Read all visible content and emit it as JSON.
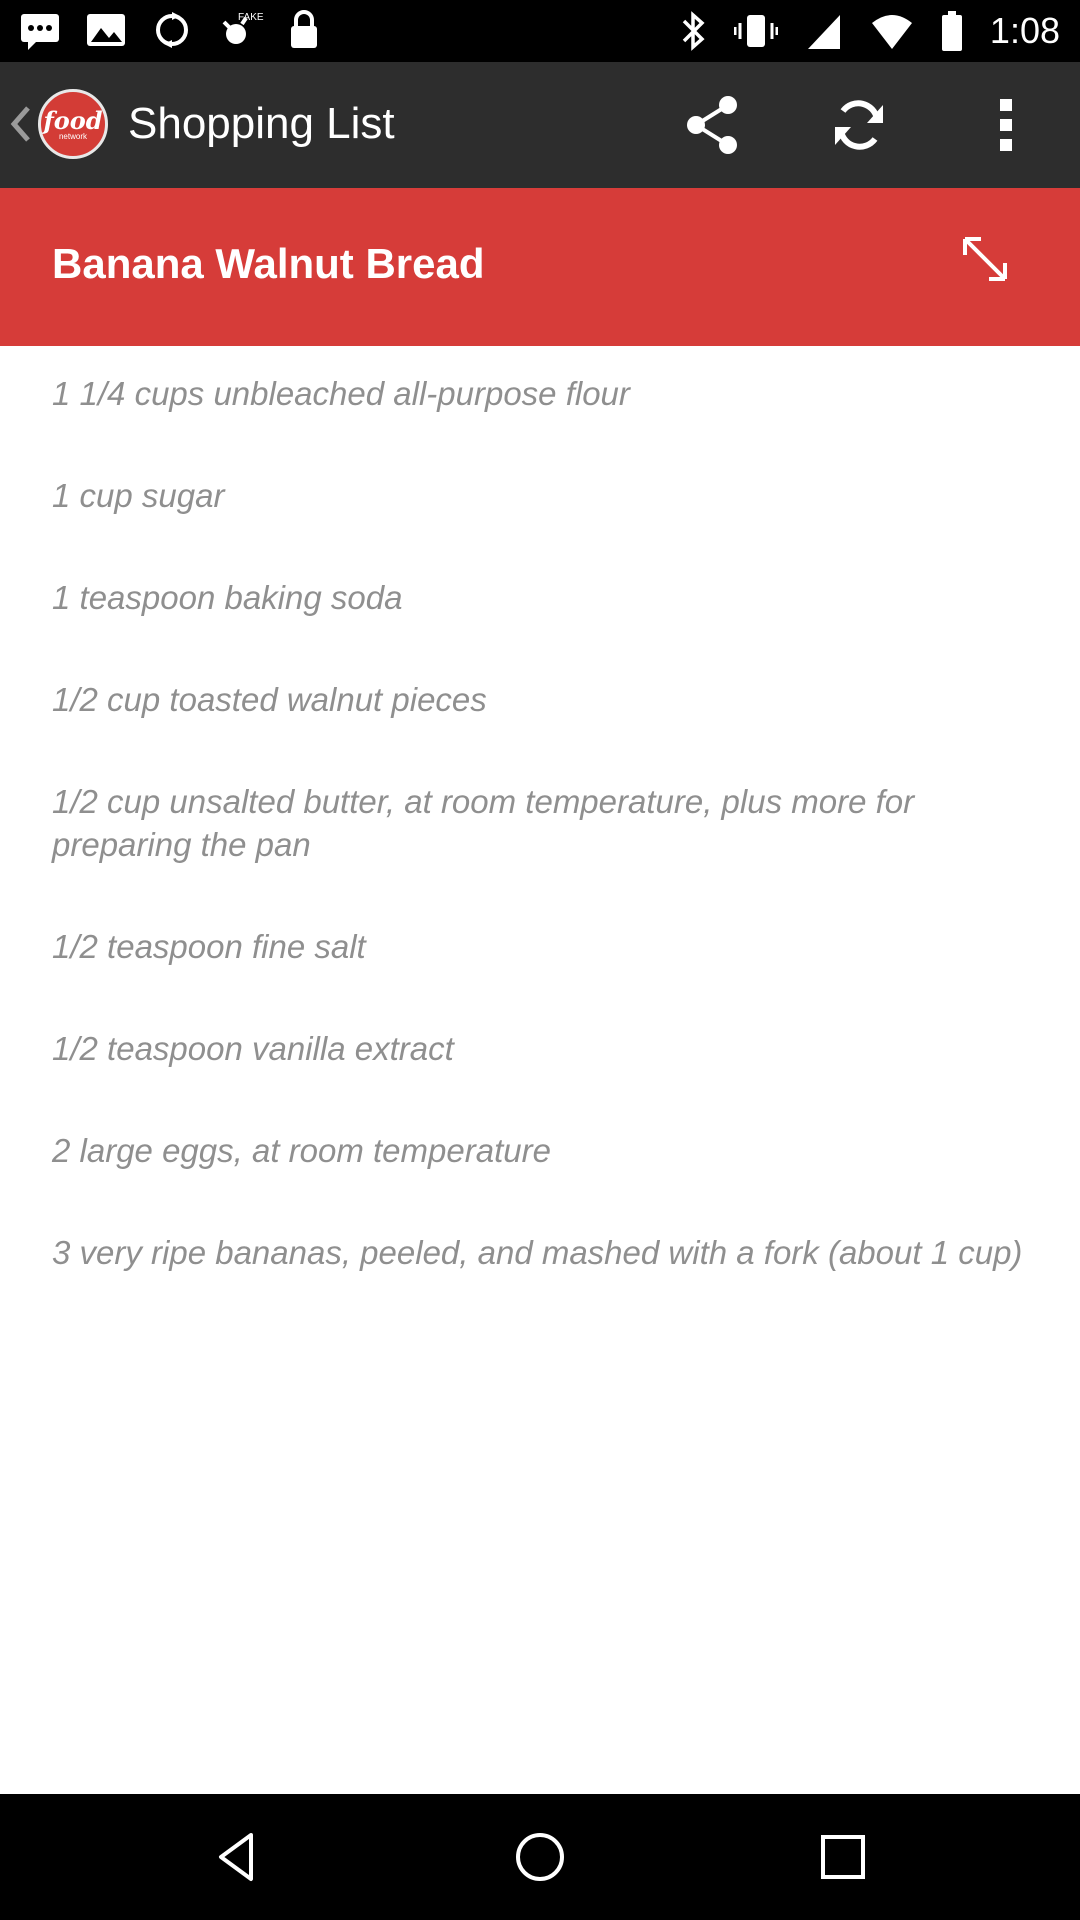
{
  "status_bar": {
    "time": "1:08",
    "icons": [
      "message-icon",
      "photo-icon",
      "sync-icon",
      "fake-gps-icon",
      "lock-icon",
      "bluetooth-icon",
      "vibrate-icon",
      "signal-icon",
      "wifi-icon",
      "battery-icon"
    ]
  },
  "action_bar": {
    "title": "Shopping List",
    "logo_text": "food",
    "logo_subtext": "network",
    "actions": [
      "share-icon",
      "refresh-icon",
      "overflow-menu-icon"
    ]
  },
  "recipe": {
    "title": "Banana Walnut Bread",
    "ingredients": [
      "1 1/4 cups unbleached all-purpose flour",
      "1 cup sugar",
      "1 teaspoon baking soda",
      "1/2 cup toasted walnut pieces",
      "1/2 cup unsalted butter, at room temperature, plus more for preparing the pan",
      "1/2 teaspoon fine salt",
      "1/2 teaspoon vanilla extract",
      "2 large eggs, at room temperature",
      "3 very ripe bananas, peeled, and mashed with a fork (about 1 cup)"
    ]
  },
  "colors": {
    "action_bar": "#2d2d2d",
    "recipe_header": "#d63c39",
    "ingredient_text": "#8f8f8f"
  },
  "nav_bar": {
    "buttons": [
      "back-icon",
      "home-icon",
      "recents-icon"
    ]
  }
}
